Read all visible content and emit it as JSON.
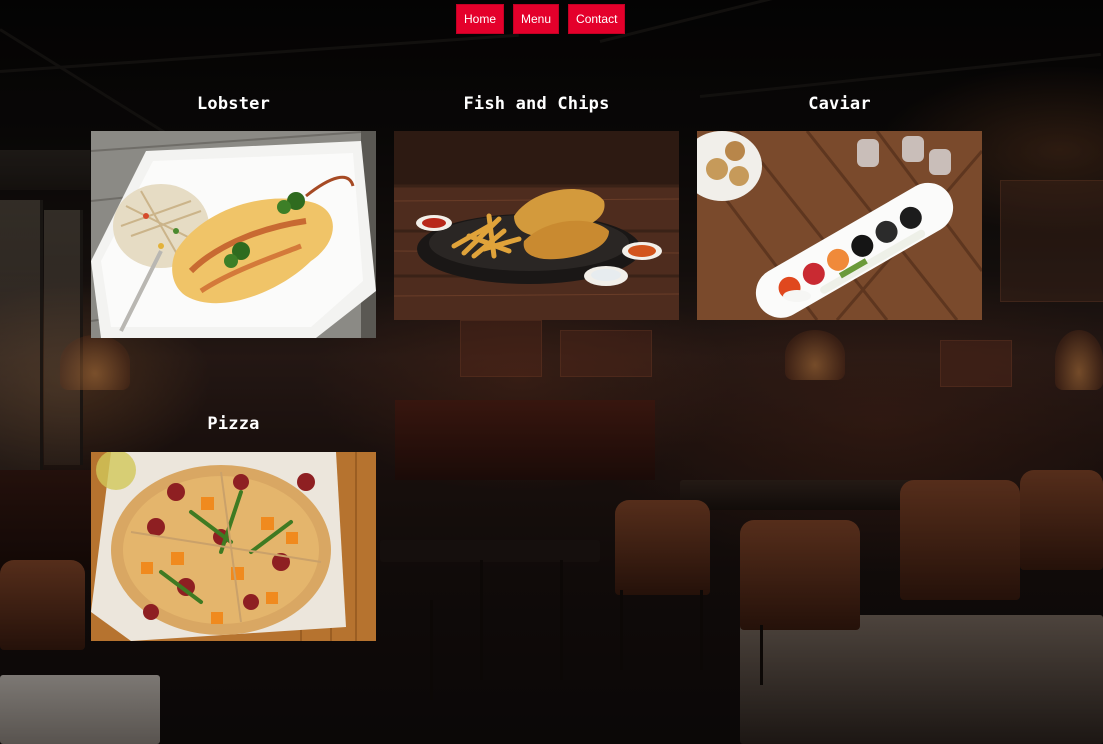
{
  "nav": {
    "items": [
      {
        "label": "Home"
      },
      {
        "label": "Menu"
      },
      {
        "label": "Contact"
      }
    ],
    "button_color": "#e4002b"
  },
  "menu": {
    "items": [
      {
        "name": "Lobster",
        "image": "lobster-photo"
      },
      {
        "name": "Fish and Chips",
        "image": "fish-and-chips-photo"
      },
      {
        "name": "Caviar",
        "image": "caviar-photo"
      },
      {
        "name": "Pizza",
        "image": "pizza-photo"
      }
    ]
  },
  "background": {
    "image": "restaurant-interior-photo"
  }
}
